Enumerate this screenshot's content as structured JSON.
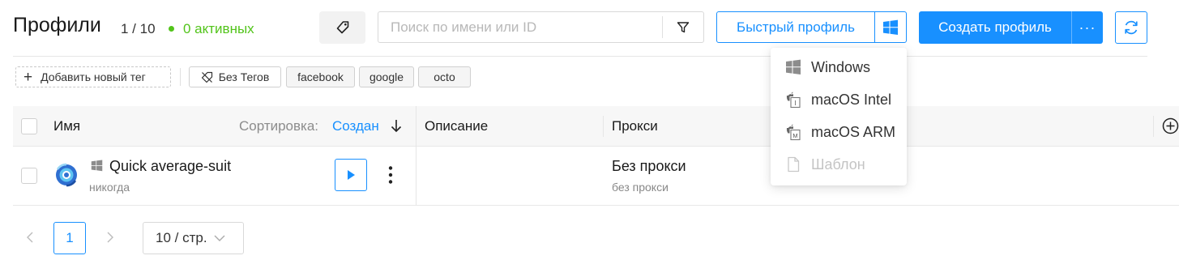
{
  "header": {
    "title": "Профили",
    "count": "1 / 10",
    "active": "0 активных",
    "search_placeholder": "Поиск по имени или ID",
    "quick_profile_label": "Быстрый профиль",
    "create_profile_label": "Создать профиль",
    "create_more_label": "···"
  },
  "tags": {
    "add_label": "Добавить новый тег",
    "items": [
      "Без Тегов",
      "facebook",
      "google",
      "octo"
    ]
  },
  "table": {
    "headers": {
      "name": "Имя",
      "sort_label": "Сортировка:",
      "sort_value": "Создан",
      "description": "Описание",
      "proxy": "Прокси"
    },
    "rows": [
      {
        "name": "Quick average-suit",
        "last_run": "никогда",
        "os_icon": "windows-icon",
        "description": "",
        "proxy": "Без прокси",
        "proxy_sub": "без прокси"
      }
    ]
  },
  "pagination": {
    "current_page": "1",
    "page_size": "10 / стр."
  },
  "os_dropdown": {
    "items": [
      {
        "label": "Windows",
        "icon": "windows-icon",
        "disabled": false
      },
      {
        "label": "macOS Intel",
        "icon": "apple-intel-icon",
        "disabled": false
      },
      {
        "label": "macOS ARM",
        "icon": "apple-arm-icon",
        "disabled": false
      },
      {
        "label": "Шаблон",
        "icon": "file-icon",
        "disabled": true
      }
    ]
  },
  "colors": {
    "primary": "#1890ff",
    "success": "#52c41a",
    "muted": "#888888"
  }
}
